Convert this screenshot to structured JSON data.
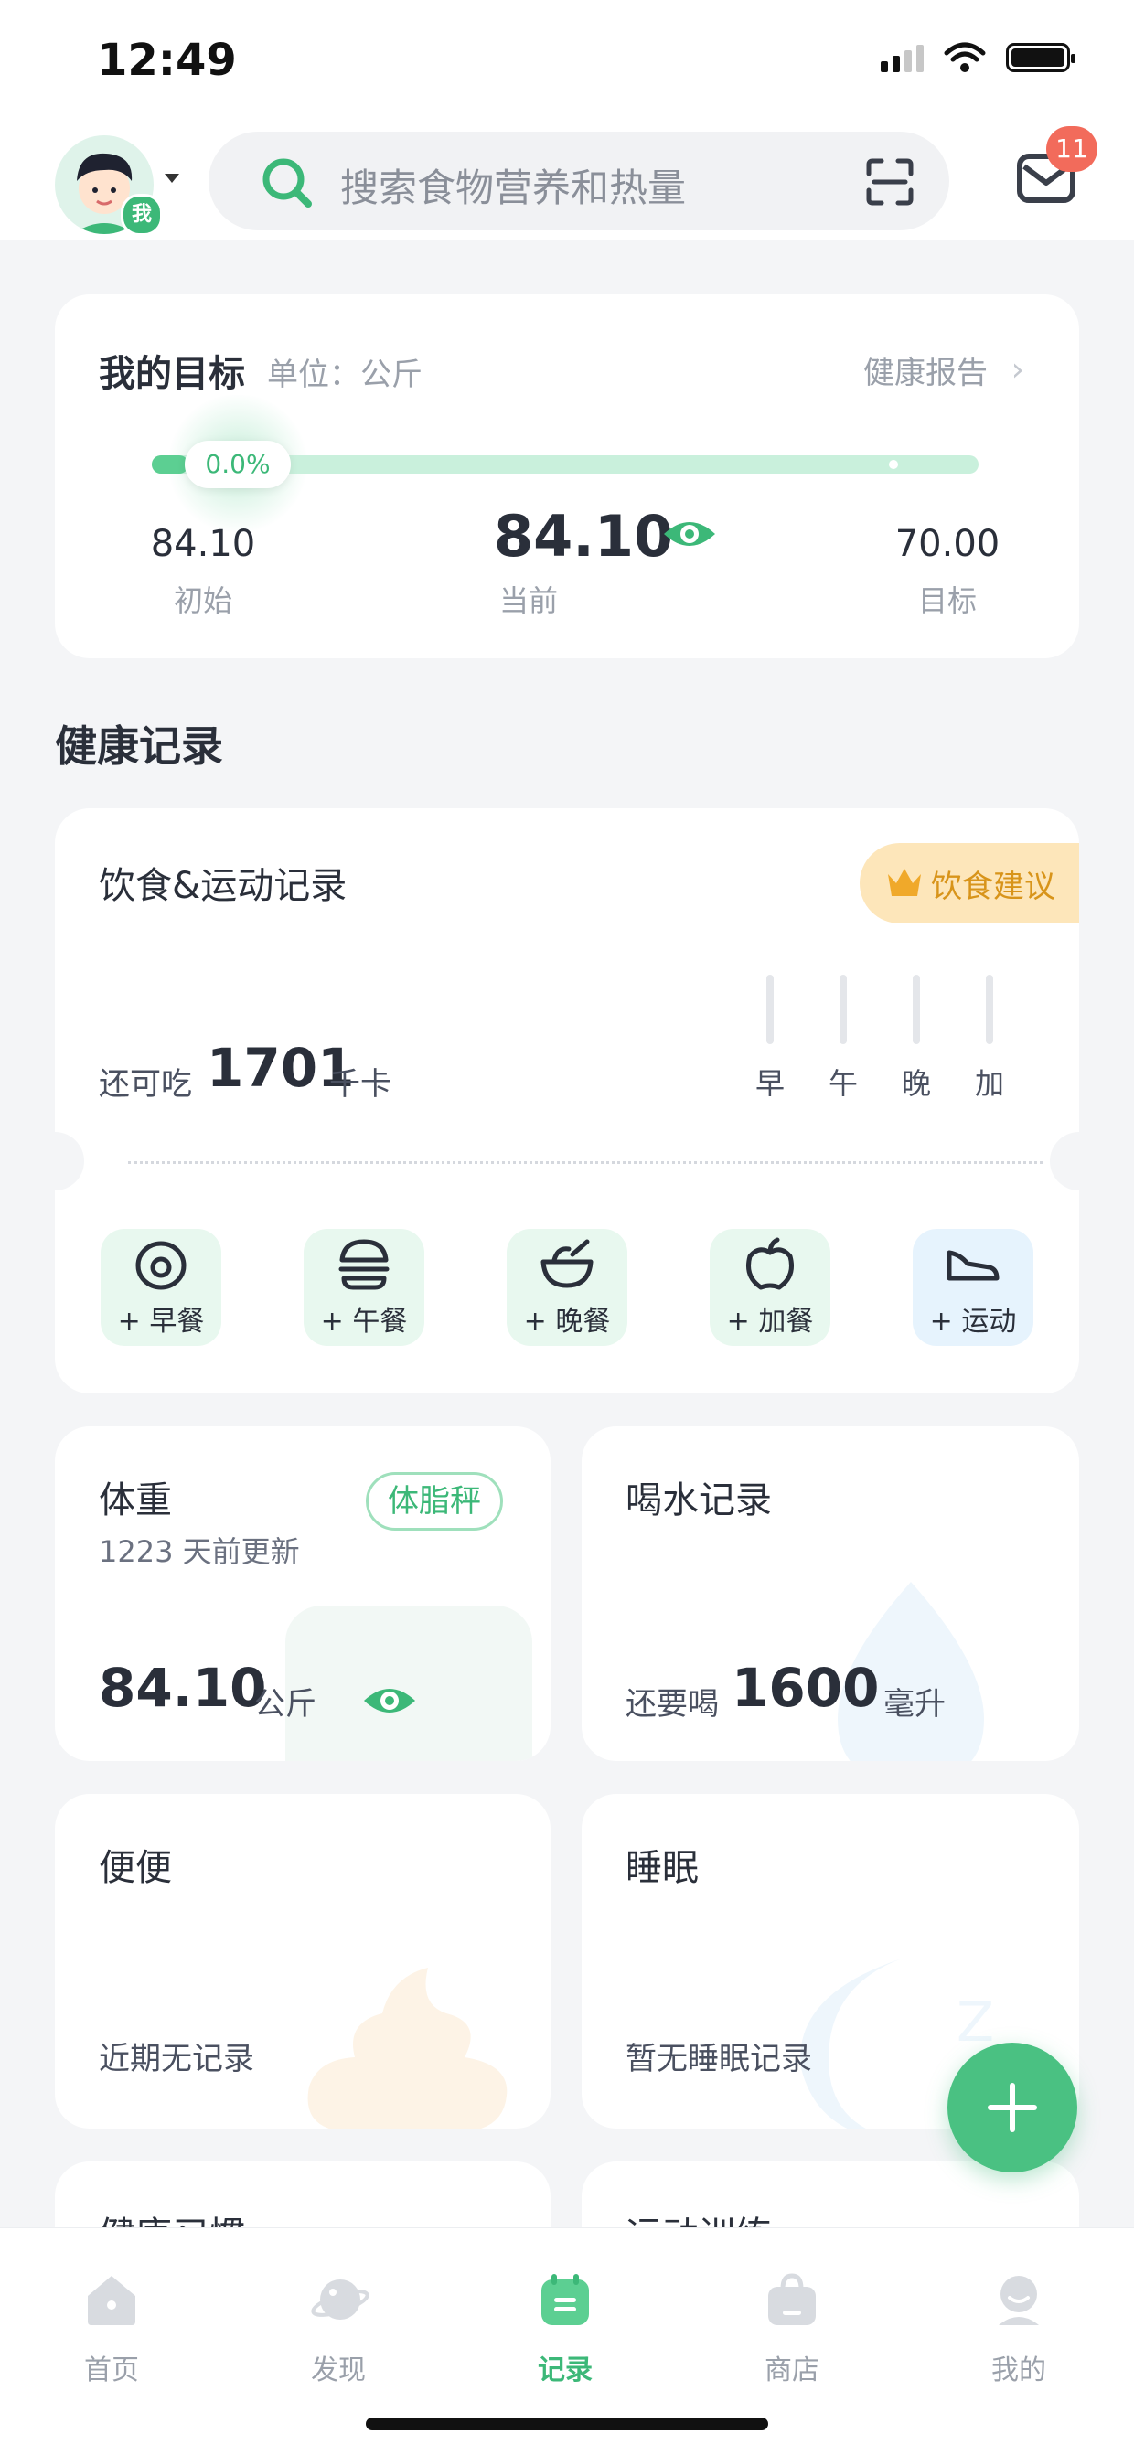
{
  "status": {
    "time": "12:49"
  },
  "header": {
    "avatar_badge": "我",
    "search_placeholder": "搜索食物营养和热量",
    "mail_count": "11"
  },
  "goal": {
    "title": "我的目标",
    "unit": "单位：公斤",
    "report": "健康报告",
    "progress": "0.0%",
    "progress_fraction": 0.0,
    "start_value": "84.10",
    "start_label": "初始",
    "current_value": "84.10",
    "current_label": "当前",
    "target_value": "70.00",
    "target_label": "目标"
  },
  "section_title": "健康记录",
  "diet": {
    "title": "饮食&运动记录",
    "advice": "饮食建议",
    "remain_label": "还可吃",
    "remain_value": "1701",
    "remain_unit": "千卡",
    "meals": [
      "早",
      "午",
      "晚",
      "加"
    ],
    "quick_add": [
      {
        "label": "+ 早餐",
        "icon": "egg-icon"
      },
      {
        "label": "+ 午餐",
        "icon": "burger-icon"
      },
      {
        "label": "+ 晚餐",
        "icon": "bowl-icon"
      },
      {
        "label": "+ 加餐",
        "icon": "apple-icon"
      },
      {
        "label": "+ 运动",
        "icon": "shoe-icon"
      }
    ]
  },
  "weight": {
    "title": "体重",
    "updated": "1223 天前更新",
    "tag": "体脂秤",
    "value": "84.10",
    "unit": "公斤"
  },
  "water": {
    "title": "喝水记录",
    "label": "还要喝",
    "value": "1600",
    "unit": "毫升"
  },
  "poop": {
    "title": "便便",
    "status": "近期无记录"
  },
  "sleep": {
    "title": "睡眠",
    "status": "暂无睡眠记录"
  },
  "partial_cards": [
    "健康习惯",
    "运动训练"
  ],
  "tabs": [
    {
      "label": "首页",
      "icon": "home-icon",
      "active": false
    },
    {
      "label": "发现",
      "icon": "planet-icon",
      "active": false
    },
    {
      "label": "记录",
      "icon": "calendar-icon",
      "active": true
    },
    {
      "label": "商店",
      "icon": "bag-icon",
      "active": false
    },
    {
      "label": "我的",
      "icon": "profile-icon",
      "active": false
    }
  ],
  "colors": {
    "accent": "#3cb878",
    "badge": "#f26b5b",
    "advice": "#d8941a"
  }
}
